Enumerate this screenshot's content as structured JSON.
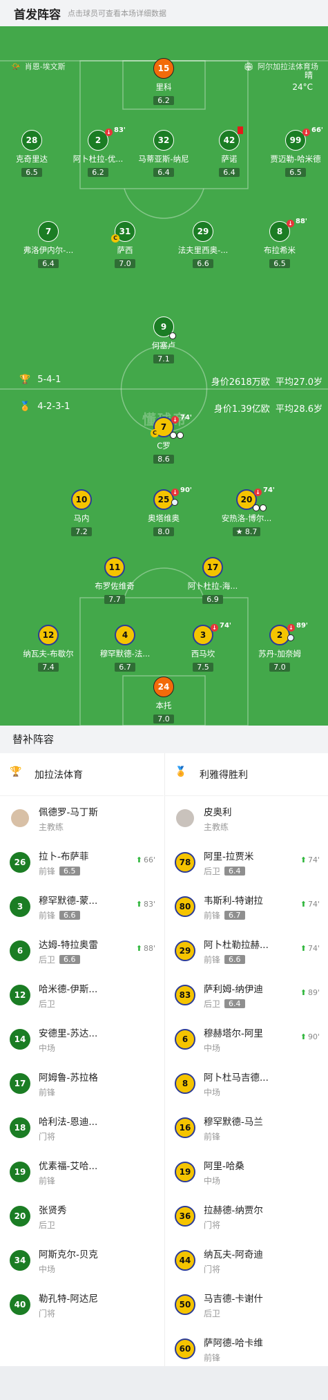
{
  "header": {
    "title": "首发阵容",
    "subtitle": "点击球员可查看本场详细数据"
  },
  "pitch": {
    "home_coach": "肖恩-埃文斯",
    "venue": "阿尔加拉法体育场",
    "weather": "晴",
    "temp": "24°C",
    "home_form": "5-4-1",
    "home_value": "身价2618万欧",
    "home_age": "平均27.0岁",
    "away_form": "4-2-3-1",
    "away_value": "身价1.39亿欧",
    "away_age": "平均28.6岁",
    "logo": "懂球帝"
  },
  "home_players": [
    {
      "no": "15",
      "name": "里科",
      "rating": "6.2",
      "gk": true
    },
    {
      "no": "28",
      "name": "克奇里达",
      "rating": "6.5"
    },
    {
      "no": "2",
      "name": "阿卜杜拉-优...",
      "rating": "6.2",
      "sub": "83'"
    },
    {
      "no": "32",
      "name": "马蒂亚斯-纳尼",
      "rating": "6.4"
    },
    {
      "no": "42",
      "name": "萨诺",
      "rating": "6.4",
      "card": true
    },
    {
      "no": "99",
      "name": "贾迈勒-哈米德",
      "rating": "6.5",
      "sub": "66'"
    },
    {
      "no": "7",
      "name": "弗洛伊内尔-...",
      "rating": "6.4"
    },
    {
      "no": "31",
      "name": "萨西",
      "rating": "7.0",
      "cap": true
    },
    {
      "no": "29",
      "name": "法夫里西奥-...",
      "rating": "6.6"
    },
    {
      "no": "8",
      "name": "布拉希米",
      "rating": "6.5",
      "sub": "88'"
    },
    {
      "no": "9",
      "name": "何塞卢",
      "rating": "7.1",
      "ball": true
    }
  ],
  "away_players": [
    {
      "no": "7",
      "name": "C罗",
      "rating": "8.6",
      "sub": "74'",
      "cap": true,
      "goals": 2
    },
    {
      "no": "10",
      "name": "马内",
      "rating": "7.2"
    },
    {
      "no": "25",
      "name": "奥塔维奥",
      "rating": "8.0",
      "sub": "90'",
      "assist": true
    },
    {
      "no": "20",
      "name": "安热洛-博尔...",
      "rating": "8.7",
      "sub": "74'",
      "star": true,
      "goals": 2
    },
    {
      "no": "11",
      "name": "布罗佐维奇",
      "rating": "7.7"
    },
    {
      "no": "17",
      "name": "阿卜杜拉-海...",
      "rating": "6.9"
    },
    {
      "no": "12",
      "name": "纳瓦夫-布歇尔",
      "rating": "7.4"
    },
    {
      "no": "4",
      "name": "穆罕默德-法...",
      "rating": "6.7"
    },
    {
      "no": "3",
      "name": "西马坎",
      "rating": "7.5",
      "sub": "74'"
    },
    {
      "no": "2",
      "name": "苏丹-加奈姆",
      "rating": "7.0",
      "sub": "89'",
      "assist": true
    },
    {
      "no": "24",
      "name": "本托",
      "rating": "7.0",
      "gk": true
    }
  ],
  "subs": {
    "title": "替补阵容",
    "home_team": "加拉法体育",
    "away_team": "利雅得胜利",
    "home_coach": {
      "name": "佩德罗-马丁斯",
      "role": "主教练"
    },
    "away_coach": {
      "name": "皮奥利",
      "role": "主教练"
    },
    "home": [
      {
        "no": "26",
        "name": "拉卜-布萨菲",
        "pos": "前锋",
        "rating": "6.5",
        "time": "66'"
      },
      {
        "no": "3",
        "name": "穆罕默德-蒙...",
        "pos": "前锋",
        "rating": "6.6",
        "time": "83'"
      },
      {
        "no": "6",
        "name": "达姆-特拉奥雷",
        "pos": "后卫",
        "rating": "6.6",
        "time": "88'"
      },
      {
        "no": "12",
        "name": "哈米德-伊斯...",
        "pos": "后卫"
      },
      {
        "no": "14",
        "name": "安德里-苏达...",
        "pos": "中场"
      },
      {
        "no": "17",
        "name": "阿姆鲁-苏拉格",
        "pos": "前锋"
      },
      {
        "no": "18",
        "name": "哈利法-恩迪...",
        "pos": "门将"
      },
      {
        "no": "19",
        "name": "优素福-艾哈...",
        "pos": "前锋"
      },
      {
        "no": "20",
        "name": "张贤秀",
        "pos": "后卫"
      },
      {
        "no": "34",
        "name": "阿斯克尔-贝克",
        "pos": "中场"
      },
      {
        "no": "40",
        "name": "勒孔特-阿达尼",
        "pos": "门将"
      }
    ],
    "away": [
      {
        "no": "78",
        "name": "阿里-拉贾米",
        "pos": "后卫",
        "rating": "6.4",
        "time": "74'"
      },
      {
        "no": "80",
        "name": "韦斯利-特谢拉",
        "pos": "前锋",
        "rating": "6.7",
        "time": "74'"
      },
      {
        "no": "29",
        "name": "阿卜杜勒拉赫...",
        "pos": "前锋",
        "rating": "6.6",
        "time": "74'"
      },
      {
        "no": "83",
        "name": "萨利姆-纳伊迪",
        "pos": "后卫",
        "rating": "6.4",
        "time": "89'"
      },
      {
        "no": "6",
        "name": "穆赫塔尔-阿里",
        "pos": "中场",
        "time": "90'"
      },
      {
        "no": "8",
        "name": "阿卜杜马吉德...",
        "pos": "中场"
      },
      {
        "no": "16",
        "name": "穆罕默德-马兰",
        "pos": "前锋"
      },
      {
        "no": "19",
        "name": "阿里-哈桑",
        "pos": "中场"
      },
      {
        "no": "36",
        "name": "拉赫德-纳贾尔",
        "pos": "门将"
      },
      {
        "no": "44",
        "name": "纳瓦夫-阿奇迪",
        "pos": "门将"
      },
      {
        "no": "50",
        "name": "马吉德-卡谢什",
        "pos": "后卫"
      },
      {
        "no": "60",
        "name": "萨阿德-哈卡维",
        "pos": "前锋"
      }
    ]
  }
}
